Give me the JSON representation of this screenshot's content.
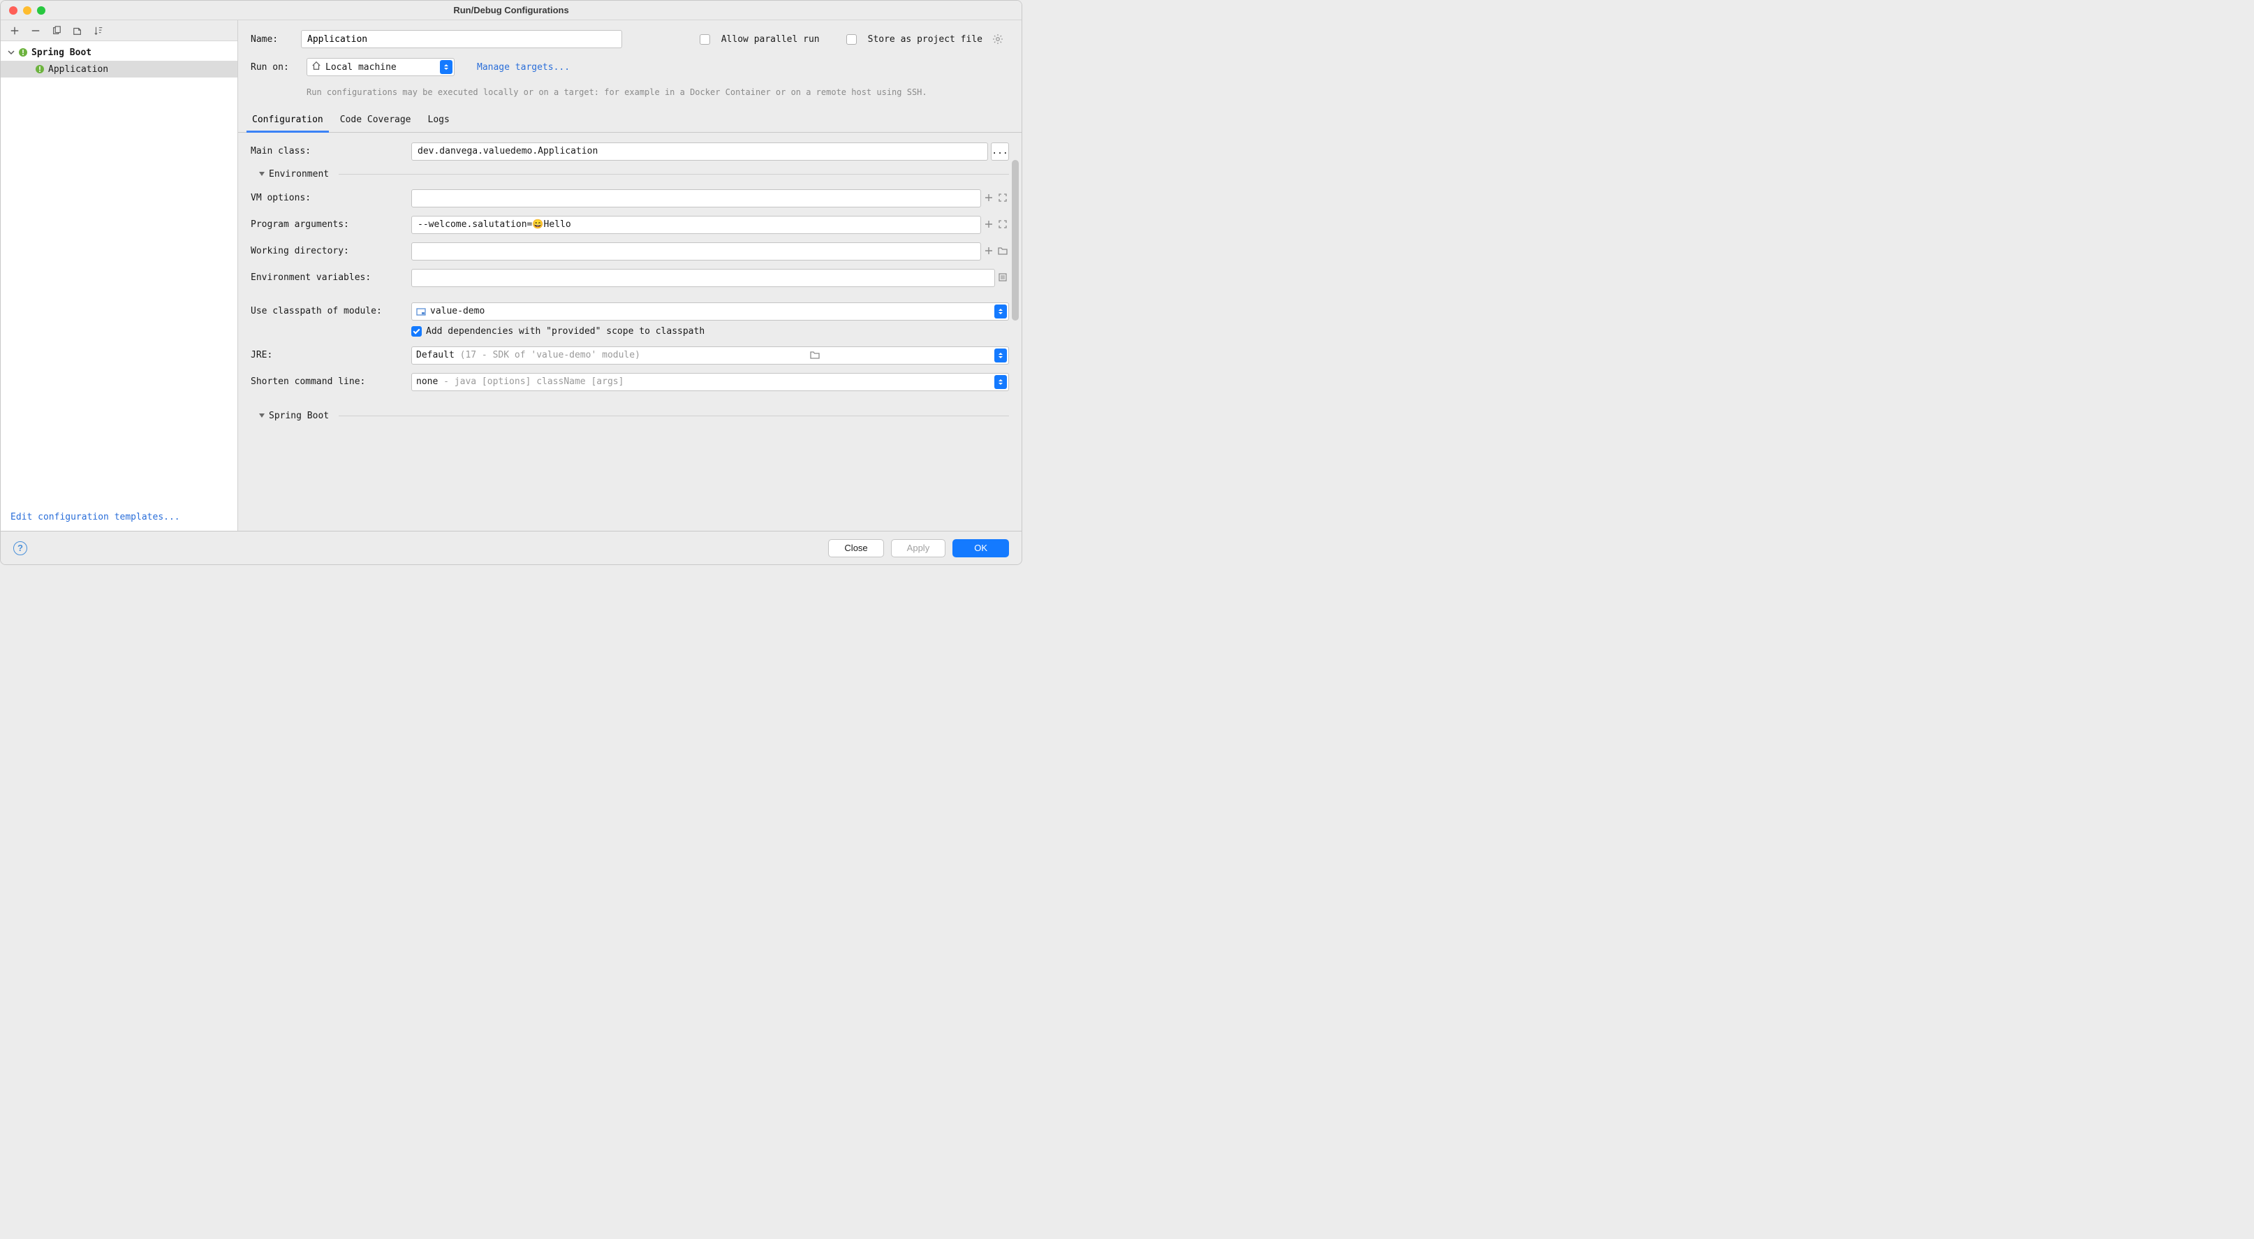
{
  "window": {
    "title": "Run/Debug Configurations"
  },
  "sidebar": {
    "root": {
      "label": "Spring Boot"
    },
    "items": [
      {
        "label": "Application"
      }
    ],
    "editTemplates": "Edit configuration templates..."
  },
  "form": {
    "nameLabel": "Name:",
    "nameValue": "Application",
    "allowParallel": "Allow parallel run",
    "storeAsProjectFile": "Store as project file",
    "runOnLabel": "Run on:",
    "runOnValue": "Local machine",
    "manageTargets": "Manage targets...",
    "hint": "Run configurations may be executed locally or on a target: for example in a Docker Container or on a remote host using SSH."
  },
  "tabs": [
    {
      "label": "Configuration",
      "active": true
    },
    {
      "label": "Code Coverage",
      "active": false
    },
    {
      "label": "Logs",
      "active": false
    }
  ],
  "config": {
    "mainClassLabel": "Main class:",
    "mainClassValue": "dev.danvega.valuedemo.Application",
    "environmentHeader": "Environment",
    "vmOptionsLabel": "VM options:",
    "vmOptionsValue": "",
    "programArgsLabel": "Program arguments:",
    "programArgsValue": "--welcome.salutation=😄Hello",
    "workingDirLabel": "Working directory:",
    "workingDirValue": "",
    "envVarsLabel": "Environment variables:",
    "envVarsValue": "",
    "classpathLabel": "Use classpath of module:",
    "classpathValue": "value-demo",
    "includeProvidedLabel": "Add dependencies with \"provided\" scope to classpath",
    "jreLabel": "JRE:",
    "jreValue": "Default",
    "jreHint": " (17 - SDK of 'value-demo' module)",
    "shortenLabel": "Shorten command line:",
    "shortenValue": "none",
    "shortenHint": " - java [options] className [args]",
    "springBootHeader": "Spring Boot"
  },
  "footer": {
    "close": "Close",
    "apply": "Apply",
    "ok": "OK"
  }
}
